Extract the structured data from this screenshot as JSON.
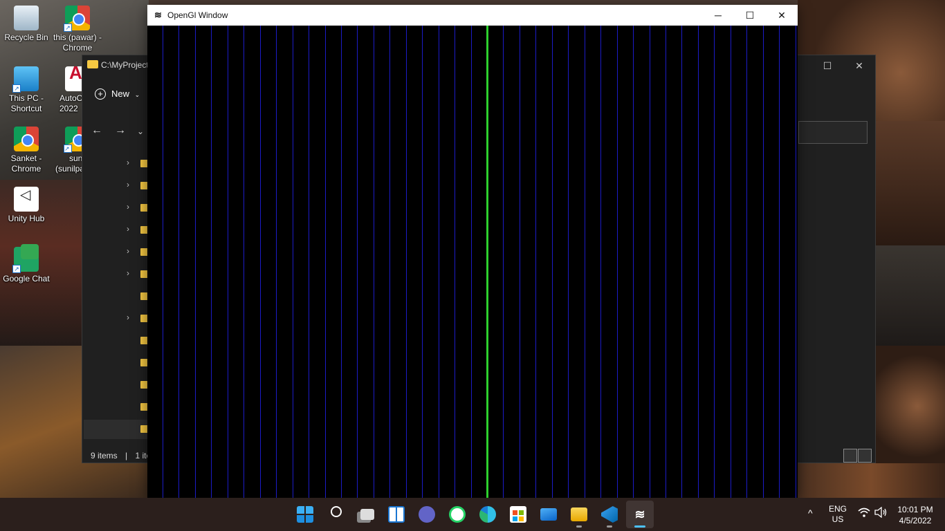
{
  "desktop": {
    "icons": [
      {
        "label_1": "Recycle Bin",
        "label_2": ""
      },
      {
        "label_1": "this (pawar) -",
        "label_2": "Chrome"
      },
      {
        "label_1": "This PC -",
        "label_2": "Shortcut"
      },
      {
        "label_1": "AutoC",
        "label_2": "2022"
      },
      {
        "label_1": "Sanket -",
        "label_2": "Chrome"
      },
      {
        "label_1": "sun",
        "label_2": "(sunilpa"
      },
      {
        "label_1": "Unity Hub",
        "label_2": ""
      },
      {
        "label_1": "Google Chat",
        "label_2": ""
      }
    ]
  },
  "explorer": {
    "path": "C:\\MyProject",
    "new_label": "New",
    "status_items": "9 items",
    "status_separator": "|",
    "status_selected": "1 ite"
  },
  "gl_window": {
    "title": "OpenGl Window",
    "app_icon": "opengl-app-icon",
    "minimize_glyph": "─",
    "maximize_glyph": "☐",
    "close_glyph": "✕",
    "background_color": "#000000",
    "grid_line_color": "#1c1cc8",
    "highlight_line_color": "#2ed12e",
    "grid_line_count": 40,
    "highlight_line_index": 20
  },
  "taskbar": {
    "apps": [
      {
        "name": "start",
        "icon": "windows-icon"
      },
      {
        "name": "search",
        "icon": "search-icon"
      },
      {
        "name": "task-view",
        "icon": "task-view-icon"
      },
      {
        "name": "widgets",
        "icon": "widgets-icon"
      },
      {
        "name": "teams-chat",
        "icon": "chat-icon"
      },
      {
        "name": "whatsapp",
        "icon": "whatsapp-icon"
      },
      {
        "name": "edge",
        "icon": "edge-icon"
      },
      {
        "name": "store",
        "icon": "store-icon"
      },
      {
        "name": "mail",
        "icon": "mail-icon"
      },
      {
        "name": "file-explorer",
        "icon": "folder-icon"
      },
      {
        "name": "vscode",
        "icon": "vscode-icon"
      },
      {
        "name": "opengl-app",
        "icon": "opengl-app-icon"
      }
    ],
    "tray": {
      "chevron": "^",
      "language_1": "ENG",
      "language_2": "US",
      "time": "10:01 PM",
      "date": "4/5/2022"
    }
  }
}
